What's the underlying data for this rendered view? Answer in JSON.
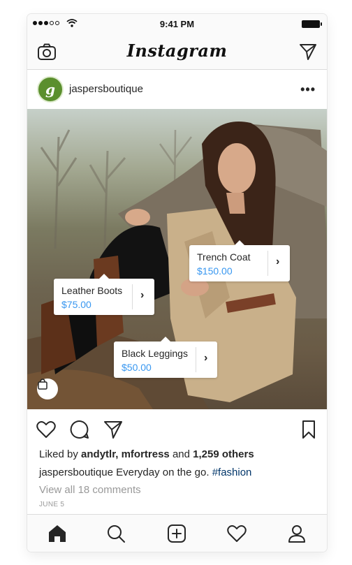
{
  "status_bar": {
    "time": "9:41 PM"
  },
  "header": {
    "logo": "Instagram"
  },
  "post": {
    "username": "jaspersboutique",
    "avatar_letter": "g",
    "more": "•••",
    "tags": [
      {
        "name": "Trench Coat",
        "price": "$150.00"
      },
      {
        "name": "Leather Boots",
        "price": "$75.00"
      },
      {
        "name": "Black Leggings",
        "price": "$50.00"
      }
    ],
    "likes": {
      "prefix": "Liked by",
      "user1": "andytlr",
      "sep": ",",
      "user2": "mfortress",
      "and": "and",
      "others": "1,259 others"
    },
    "caption": {
      "user": "jaspersboutique",
      "text": "Everyday on the go.",
      "hashtag": "#fashion"
    },
    "comments_link": "View all 18 comments",
    "date": "JUNE 5"
  },
  "colors": {
    "link_blue": "#3897f0",
    "hashtag": "#003569",
    "border": "#dbdbdb"
  },
  "icons": [
    "camera-icon",
    "direct-icon",
    "heart-icon",
    "comment-icon",
    "share-icon",
    "bookmark-icon",
    "shopping-bag-icon",
    "home-icon",
    "search-icon",
    "add-icon",
    "activity-icon",
    "profile-icon"
  ]
}
